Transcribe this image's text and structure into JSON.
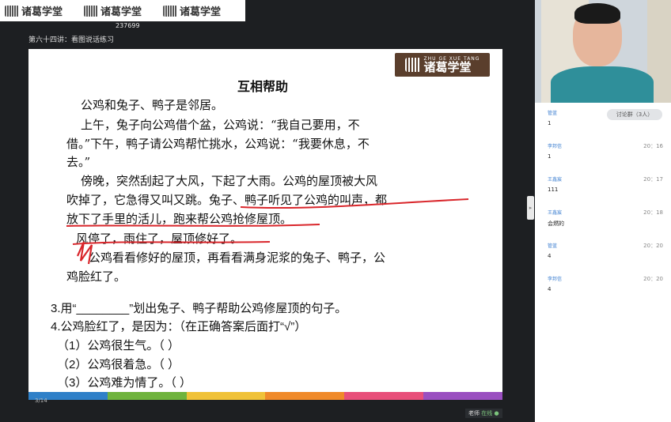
{
  "header": {
    "logos": [
      {
        "pinyin": "ZHU GE XUE TANG",
        "name": "诸葛学堂"
      },
      {
        "pinyin": "ZHU GE XUE TANG",
        "name": "诸葛学堂"
      },
      {
        "pinyin": "ZHU GE XUE TANG",
        "name": "诸葛学堂"
      }
    ],
    "room_id": "237699",
    "lesson_title": "第六十四讲：看图说话练习"
  },
  "slide": {
    "logo": {
      "pinyin": "ZHU GE XUE TANG",
      "name": "诸葛学堂"
    },
    "title": "互相帮助",
    "lines": [
      "公鸡和兔子、鸭子是邻居。",
      "上午，兔子向公鸡借个盆，公鸡说：“我自己要用，不",
      "借。”下午，鸭子请公鸡帮忙挑水，公鸡说：“我要休息，不",
      "去。”",
      "傍晚，突然刮起了大风，下起了大雨。公鸡的屋顶被大风",
      "吹掉了，它急得又叫又跳。兔子、鸭子听见了公鸡的叫声，都",
      "放下了手里的活儿，跑来帮公鸡抢修屋顶。",
      "风停了，雨住了，屋顶修好了。",
      "公鸡看看修好的屋顶，再看看满身泥浆的兔子、鸭子，公",
      "鸡脸红了。"
    ],
    "questions": [
      "3.用“________”划出兔子、鸭子帮助公鸡修屋顶的句子。",
      "4.公鸡脸红了，是因为：（在正确答案后面打“√”）",
      "（1）公鸡很生气。（      ）",
      "（2）公鸡很着急。（      ）",
      "（3）公鸡难为情了。（      ）"
    ],
    "page_num": "3/14",
    "presenter_label": "老师",
    "presenter_status": "在线 ●",
    "bar_colors": [
      "#2f80c8",
      "#6fb33d",
      "#f0c238",
      "#f08a2a",
      "#e84f7a",
      "#9a4fc0"
    ]
  },
  "chat": {
    "toggle_label": "讨论群（3人）",
    "messages": [
      {
        "name": "管蓝",
        "time": "",
        "msg": "1"
      },
      {
        "name": "李邦信",
        "time": "20：16",
        "msg": "1"
      },
      {
        "name": "王鑫宸",
        "time": "20：17",
        "msg": "111"
      },
      {
        "name": "王鑫宸",
        "time": "20：18",
        "msg": "会燃的"
      },
      {
        "name": "管蓝",
        "time": "20：20",
        "msg": "4"
      },
      {
        "name": "李邦信",
        "time": "20：20",
        "msg": "4"
      }
    ]
  }
}
